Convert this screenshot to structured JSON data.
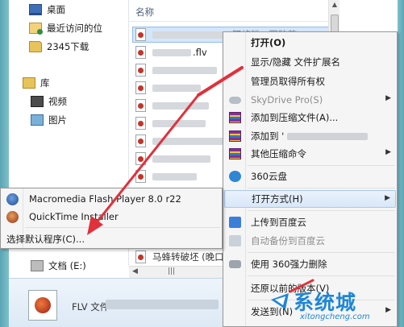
{
  "nav": {
    "items": [
      {
        "label": "桌面",
        "icon": "desktop-icon"
      },
      {
        "label": "最近访问的位",
        "icon": "recent-places-icon"
      },
      {
        "label": "2345下载",
        "icon": "folder-icon"
      },
      {
        "label": "库",
        "icon": "libraries-icon"
      },
      {
        "label": "视频",
        "icon": "video-library-icon"
      },
      {
        "label": "图片",
        "icon": "pictures-library-icon"
      },
      {
        "label": "文档 (E:)",
        "icon": "drive-icon"
      }
    ]
  },
  "file_list": {
    "column_header": "名称",
    "visible_name_fragment": ".flv",
    "selected_row_fragment": "阳蜂粉 · 跟踪节 ·",
    "bottom_row_fragment": "马蜂转破坯 (晚口"
  },
  "details": {
    "file_type": "FLV 文件"
  },
  "context_menu": {
    "items": {
      "open": "打开(O)",
      "toggle_ext": "显示/隐藏 文件扩展名",
      "take_ownership": "管理员取得所有权",
      "skydrive": "SkyDrive Pro(S)",
      "add_to_archive": "添加到压缩文件(A)...",
      "add_to_named": "添加到 '",
      "other_compress": "其他压缩命令",
      "cloud_360": "360云盘",
      "open_with": "打开方式(H)",
      "upload_baidu": "上传到百度云",
      "auto_backup_baidu": "自动备份到百度云",
      "force_delete_360": "使用 360强力删除",
      "restore_previous": "还原以前的版本(V)",
      "send_to": "发送到(N)"
    },
    "submenu_arrow": "▶"
  },
  "open_with_submenu": {
    "items": {
      "flash_player": "Macromedia Flash Player 8.0  r22",
      "quicktime": "QuickTime Installer",
      "choose_default": "选择默认程序(C)..."
    }
  },
  "annotation": {
    "arrow_color": "#e0313c"
  },
  "watermark": {
    "name": "系统城",
    "url": "xitongcheng.com"
  }
}
